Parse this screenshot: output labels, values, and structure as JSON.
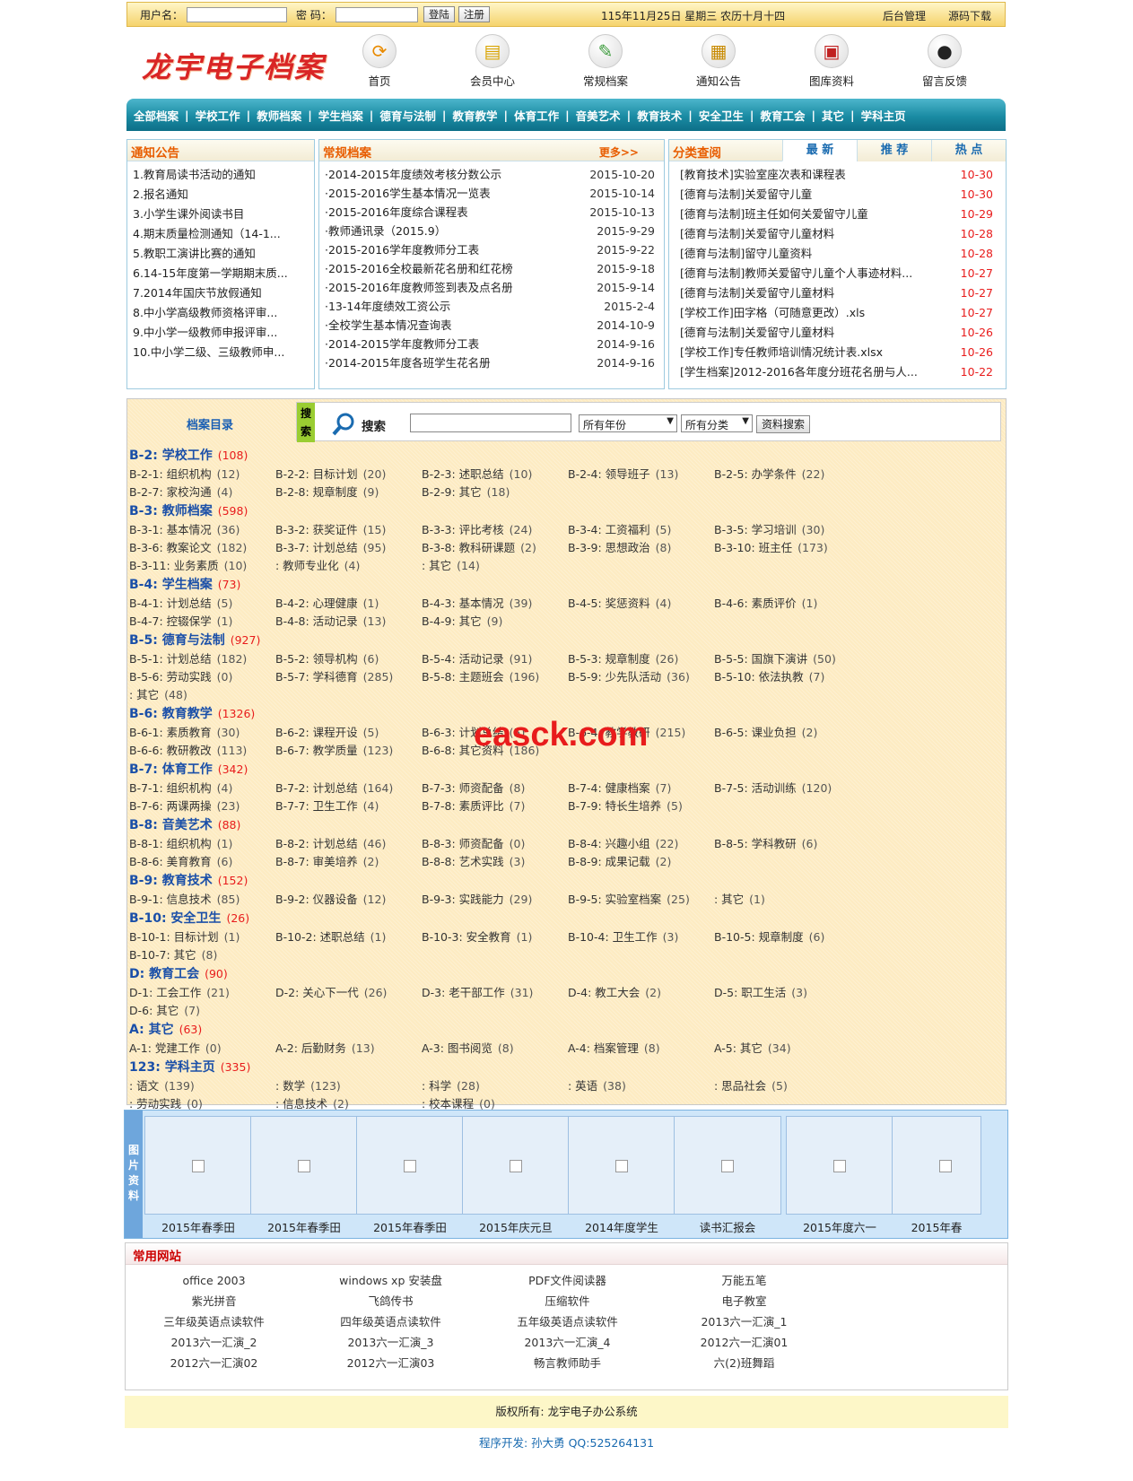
{
  "login": {
    "user_label": "用户名：",
    "pwd_label": "密 码：",
    "login_btn": "登陆",
    "register_btn": "注册",
    "date": "115年11月25日 星期三 农历十月十四",
    "admin": "后台管理",
    "source": "源码下载"
  },
  "logo": "龙宇电子档案",
  "nav_icons": [
    {
      "label": "首页",
      "icon": "home-icon"
    },
    {
      "label": "会员中心",
      "icon": "bag-icon"
    },
    {
      "label": "常规档案",
      "icon": "folder-icon"
    },
    {
      "label": "通知公告",
      "icon": "book-icon"
    },
    {
      "label": "图库资料",
      "icon": "monitor-icon"
    },
    {
      "label": "留言反馈",
      "icon": "qq-icon"
    }
  ],
  "main_nav": [
    "全部档案",
    "学校工作",
    "教师档案",
    "学生档案",
    "德育与法制",
    "教育教学",
    "体育工作",
    "音美艺术",
    "教育技术",
    "安全卫生",
    "教育工会",
    "其它",
    "学科主页"
  ],
  "notice": {
    "title": "通知公告",
    "items": [
      "1.教育局读书活动的通知",
      "2.报名通知",
      "3.小学生课外阅读书目",
      "4.期末质量检测通知（14-1...",
      "5.教职工演讲比赛的通知",
      "6.14-15年度第一学期期末质...",
      "7.2014年国庆节放假通知",
      "8.中小学高级教师资格评审...",
      "9.中小学一级教师申报评审...",
      "10.中小学二级、三级教师申..."
    ]
  },
  "archive": {
    "title": "常规档案",
    "more": "更多>>",
    "items": [
      [
        "·2014-2015年度绩效考核分数公示",
        "2015-10-20"
      ],
      [
        "·2015-2016学生基本情况一览表",
        "2015-10-14"
      ],
      [
        "·2015-2016年度综合课程表",
        "2015-10-13"
      ],
      [
        "·教师通讯录（2015.9）",
        "2015-9-29"
      ],
      [
        "·2015-2016学年度教师分工表",
        "2015-9-22"
      ],
      [
        "·2015-2016全校最新花名册和红花榜",
        "2015-9-18"
      ],
      [
        "·2015-2016年度教师签到表及点名册",
        "2015-9-14"
      ],
      [
        "·13-14年度绩效工资公示",
        "2015-2-4"
      ],
      [
        "·全校学生基本情况查询表",
        "2014-10-9"
      ],
      [
        "·2014-2015学年度教师分工表",
        "2014-9-16"
      ],
      [
        "·2014-2015年度各班学生花名册",
        "2014-9-16"
      ]
    ]
  },
  "classify": {
    "title": "分类查阅",
    "tabs": [
      "最 新",
      "推 荐",
      "热 点"
    ],
    "items": [
      [
        "[教育技术]实验室座次表和课程表",
        "10-30"
      ],
      [
        "[德育与法制]关爱留守儿童",
        "10-30"
      ],
      [
        "[德育与法制]班主任如何关爱留守儿童",
        "10-29"
      ],
      [
        "[德育与法制]关爱留守儿童材料",
        "10-28"
      ],
      [
        "[德育与法制]留守儿童资料",
        "10-28"
      ],
      [
        "[德育与法制]教师关爱留守儿童个人事迹材料...",
        "10-27"
      ],
      [
        "[德育与法制]关爱留守儿童材料",
        "10-27"
      ],
      [
        "[学校工作]田字格（可随意更改）.xls",
        "10-27"
      ],
      [
        "[德育与法制]关爱留守儿童材料",
        "10-26"
      ],
      [
        "[学校工作]专任教师培训情况统计表.xlsx",
        "10-26"
      ],
      [
        "[学生档案]2012-2016各年度分班花名册与人...",
        "10-22"
      ]
    ]
  },
  "search": {
    "cat_title": "档案目录",
    "tag": "搜索",
    "label": "搜索",
    "year": "所有年份",
    "category": "所有分类",
    "button": "资料搜索"
  },
  "categories": [
    {
      "title": "B-2: 学校工作",
      "count": "(108)",
      "items": [
        [
          "B-2-1: 组织机构",
          "(12)"
        ],
        [
          "B-2-2: 目标计划",
          "(20)"
        ],
        [
          "B-2-3: 述职总结",
          "(10)"
        ],
        [
          "B-2-4: 领导班子",
          "(13)"
        ],
        [
          "B-2-5: 办学条件",
          "(22)"
        ],
        [
          "B-2-7: 家校沟通",
          "(4)"
        ],
        [
          "B-2-8: 规章制度",
          "(9)"
        ],
        [
          "B-2-9: 其它",
          "(18)"
        ]
      ]
    },
    {
      "title": "B-3: 教师档案",
      "count": "(598)",
      "items": [
        [
          "B-3-1: 基本情况",
          "(36)"
        ],
        [
          "B-3-2: 获奖证件",
          "(15)"
        ],
        [
          "B-3-3: 评比考核",
          "(24)"
        ],
        [
          "B-3-4: 工资福利",
          "(5)"
        ],
        [
          "B-3-5: 学习培训",
          "(30)"
        ],
        [
          "B-3-6: 教案论文",
          "(182)"
        ],
        [
          "B-3-7: 计划总结",
          "(95)"
        ],
        [
          "B-3-8: 教科研课题",
          "(2)"
        ],
        [
          "B-3-9: 思想政治",
          "(8)"
        ],
        [
          "B-3-10: 班主任",
          "(173)"
        ],
        [
          "B-3-11: 业务素质",
          "(10)"
        ],
        [
          ": 教师专业化",
          "(4)"
        ],
        [
          ": 其它",
          "(14)"
        ]
      ]
    },
    {
      "title": "B-4: 学生档案",
      "count": "(73)",
      "items": [
        [
          "B-4-1: 计划总结",
          "(5)"
        ],
        [
          "B-4-2: 心理健康",
          "(1)"
        ],
        [
          "B-4-3: 基本情况",
          "(39)"
        ],
        [
          "B-4-5: 奖惩资料",
          "(4)"
        ],
        [
          "B-4-6: 素质评价",
          "(1)"
        ],
        [
          "B-4-7: 控辍保学",
          "(1)"
        ],
        [
          "B-4-8: 活动记录",
          "(13)"
        ],
        [
          "B-4-9: 其它",
          "(9)"
        ]
      ]
    },
    {
      "title": "B-5: 德育与法制",
      "count": "(927)",
      "items": [
        [
          "B-5-1: 计划总结",
          "(182)"
        ],
        [
          "B-5-2: 领导机构",
          "(6)"
        ],
        [
          "B-5-4: 活动记录",
          "(91)"
        ],
        [
          "B-5-3: 规章制度",
          "(26)"
        ],
        [
          "B-5-5: 国旗下演讲",
          "(50)"
        ],
        [
          "B-5-6: 劳动实践",
          "(0)"
        ],
        [
          "B-5-7: 学科德育",
          "(285)"
        ],
        [
          "B-5-8: 主题班会",
          "(196)"
        ],
        [
          "B-5-9: 少先队活动",
          "(36)"
        ],
        [
          "B-5-10: 依法执教",
          "(7)"
        ],
        [
          ": 其它",
          "(48)"
        ]
      ]
    },
    {
      "title": "B-6: 教育教学",
      "count": "(1326)",
      "items": [
        [
          "B-6-1: 素质教育",
          "(30)"
        ],
        [
          "B-6-2: 课程开设",
          "(5)"
        ],
        [
          "B-6-3: 计划总结",
          "(5)"
        ],
        [
          "B-6-4: 教学教研",
          "(215)"
        ],
        [
          "B-6-5: 课业负担",
          "(2)"
        ],
        [
          "B-6-6: 教研教改",
          "(113)"
        ],
        [
          "B-6-7: 教学质量",
          "(123)"
        ],
        [
          "B-6-8: 其它资料",
          "(186)"
        ]
      ]
    },
    {
      "title": "B-7: 体育工作",
      "count": "(342)",
      "items": [
        [
          "B-7-1: 组织机构",
          "(4)"
        ],
        [
          "B-7-2: 计划总结",
          "(164)"
        ],
        [
          "B-7-3: 师资配备",
          "(8)"
        ],
        [
          "B-7-4: 健康档案",
          "(7)"
        ],
        [
          "B-7-5: 活动训练",
          "(120)"
        ],
        [
          "B-7-6: 两课两操",
          "(23)"
        ],
        [
          "B-7-7: 卫生工作",
          "(4)"
        ],
        [
          "B-7-8: 素质评比",
          "(7)"
        ],
        [
          "B-7-9: 特长生培养",
          "(5)"
        ]
      ]
    },
    {
      "title": "B-8: 音美艺术",
      "count": "(88)",
      "items": [
        [
          "B-8-1: 组织机构",
          "(1)"
        ],
        [
          "B-8-2: 计划总结",
          "(46)"
        ],
        [
          "B-8-3: 师资配备",
          "(0)"
        ],
        [
          "B-8-4: 兴趣小组",
          "(22)"
        ],
        [
          "B-8-5: 学科教研",
          "(6)"
        ],
        [
          "B-8-6: 美育教育",
          "(6)"
        ],
        [
          "B-8-7: 审美培养",
          "(2)"
        ],
        [
          "B-8-8: 艺术实践",
          "(3)"
        ],
        [
          "B-8-9: 成果记载",
          "(2)"
        ]
      ]
    },
    {
      "title": "B-9: 教育技术",
      "count": "(152)",
      "items": [
        [
          "B-9-1: 信息技术",
          "(85)"
        ],
        [
          "B-9-2: 仪器设备",
          "(12)"
        ],
        [
          "B-9-3: 实践能力",
          "(29)"
        ],
        [
          "B-9-5: 实验室档案",
          "(25)"
        ],
        [
          ": 其它",
          "(1)"
        ]
      ]
    },
    {
      "title": "B-10: 安全卫生",
      "count": "(26)",
      "items": [
        [
          "B-10-1: 目标计划",
          "(1)"
        ],
        [
          "B-10-2: 述职总结",
          "(1)"
        ],
        [
          "B-10-3: 安全教育",
          "(1)"
        ],
        [
          "B-10-4: 卫生工作",
          "(3)"
        ],
        [
          "B-10-5: 规章制度",
          "(6)"
        ],
        [
          "B-10-7: 其它",
          "(8)"
        ]
      ]
    },
    {
      "title": "D: 教育工会",
      "count": "(90)",
      "items": [
        [
          "D-1: 工会工作",
          "(21)"
        ],
        [
          "D-2: 关心下一代",
          "(26)"
        ],
        [
          "D-3: 老干部工作",
          "(31)"
        ],
        [
          "D-4: 教工大会",
          "(2)"
        ],
        [
          "D-5: 职工生活",
          "(3)"
        ],
        [
          "D-6: 其它",
          "(7)"
        ]
      ]
    },
    {
      "title": "A: 其它",
      "count": "(63)",
      "items": [
        [
          "A-1: 党建工作",
          "(0)"
        ],
        [
          "A-2: 后勤财务",
          "(13)"
        ],
        [
          "A-3: 图书阅览",
          "(8)"
        ],
        [
          "A-4: 档案管理",
          "(8)"
        ],
        [
          "A-5: 其它",
          "(34)"
        ]
      ]
    },
    {
      "title": "123: 学科主页",
      "count": "(335)",
      "items": [
        [
          ": 语文",
          "(139)"
        ],
        [
          ": 数学",
          "(123)"
        ],
        [
          ": 科学",
          "(28)"
        ],
        [
          ": 英语",
          "(38)"
        ],
        [
          ": 思品社会",
          "(5)"
        ],
        [
          ": 劳动实践",
          "(0)"
        ],
        [
          ": 信息技术",
          "(2)"
        ],
        [
          ": 校本课程",
          "(0)"
        ]
      ]
    }
  ],
  "watermark": "easck.com",
  "pictures": {
    "tag": "图片资料",
    "items": [
      "2015年春季田",
      "2015年春季田",
      "2015年春季田",
      "2015年庆元旦",
      "2014年度学生",
      "读书汇报会",
      "2015年度六一",
      "2015年春"
    ]
  },
  "links": {
    "title": "常用网站",
    "items": [
      "office 2003",
      "windows xp 安装盘",
      "PDF文件阅读器",
      "万能五笔",
      "紫光拼音",
      "飞鸽传书",
      "压缩软件",
      "电子教室",
      "三年级英语点读软件",
      "四年级英语点读软件",
      "五年级英语点读软件",
      "2013六一汇演_1",
      "2013六一汇演_2",
      "2013六一汇演_3",
      "2013六一汇演_4",
      "2012六一汇演01",
      "2012六一汇演02",
      "2012六一汇演03",
      "畅言教师助手",
      "六(2)班舞蹈"
    ]
  },
  "footer": "版权所有: 龙宇电子办公系统",
  "developer": "程序开发: 孙大勇 QQ:525264131"
}
